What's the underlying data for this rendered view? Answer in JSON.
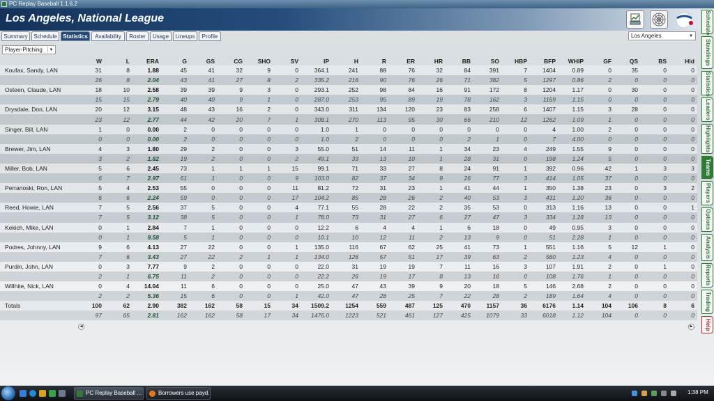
{
  "window": {
    "title": "PC Replay Baseball 1.1.6.2"
  },
  "header": {
    "team_title": "Los Angeles, National League"
  },
  "tabs": [
    "Summary",
    "Schedule",
    "Statistics",
    "Availability",
    "Roster",
    "Usage",
    "Lineups",
    "Profile"
  ],
  "active_tab": "Statistics",
  "team_select": {
    "value": "Los Angeles"
  },
  "view_select": {
    "value": "Player-Pitching"
  },
  "columns": [
    "W",
    "L",
    "ERA",
    "G",
    "GS",
    "CG",
    "SHO",
    "SV",
    "IP",
    "H",
    "R",
    "ER",
    "HR",
    "BB",
    "SO",
    "HBP",
    "BFP",
    "WHIP",
    "GF",
    "QS",
    "BS",
    "Hld"
  ],
  "rows": [
    {
      "name": "Koufax, Sandy, LAN",
      "kind": "main",
      "v": [
        "31",
        "8",
        "1.88",
        "45",
        "41",
        "32",
        "9",
        "0",
        "364.1",
        "241",
        "88",
        "76",
        "32",
        "84",
        "391",
        "7",
        "1404",
        "0.89",
        "0",
        "35",
        "0",
        "0"
      ]
    },
    {
      "name": "",
      "kind": "proj",
      "v": [
        "26",
        "8",
        "2.04",
        "43",
        "41",
        "27",
        "8",
        "2",
        "335.2",
        "216",
        "90",
        "76",
        "26",
        "71",
        "382",
        "5",
        "1297",
        "0.86",
        "2",
        "0",
        "0",
        "0"
      ]
    },
    {
      "name": "Osteen, Claude, LAN",
      "kind": "main",
      "v": [
        "18",
        "10",
        "2.58",
        "39",
        "39",
        "9",
        "3",
        "0",
        "293.1",
        "252",
        "98",
        "84",
        "16",
        "91",
        "172",
        "8",
        "1204",
        "1.17",
        "0",
        "30",
        "0",
        "0"
      ]
    },
    {
      "name": "",
      "kind": "proj",
      "v": [
        "15",
        "15",
        "2.79",
        "40",
        "40",
        "9",
        "1",
        "0",
        "287.0",
        "253",
        "95",
        "89",
        "19",
        "78",
        "162",
        "3",
        "1169",
        "1.15",
        "0",
        "0",
        "0",
        "0"
      ]
    },
    {
      "name": "Drysdale, Don, LAN",
      "kind": "main",
      "v": [
        "20",
        "12",
        "3.15",
        "48",
        "43",
        "16",
        "2",
        "0",
        "343.0",
        "311",
        "134",
        "120",
        "23",
        "83",
        "258",
        "6",
        "1407",
        "1.15",
        "3",
        "28",
        "0",
        "0"
      ]
    },
    {
      "name": "",
      "kind": "proj",
      "v": [
        "23",
        "12",
        "2.77",
        "44",
        "42",
        "20",
        "7",
        "1",
        "308.1",
        "270",
        "113",
        "95",
        "30",
        "66",
        "210",
        "12",
        "1262",
        "1.09",
        "1",
        "0",
        "0",
        "0"
      ]
    },
    {
      "name": "Singer, Bill, LAN",
      "kind": "main",
      "v": [
        "1",
        "0",
        "0.00",
        "2",
        "0",
        "0",
        "0",
        "0",
        "1.0",
        "1",
        "0",
        "0",
        "0",
        "0",
        "0",
        "0",
        "4",
        "1.00",
        "2",
        "0",
        "0",
        "0"
      ]
    },
    {
      "name": "",
      "kind": "proj",
      "v": [
        "0",
        "0",
        "0.00",
        "2",
        "0",
        "0",
        "0",
        "0",
        "1.0",
        "2",
        "0",
        "0",
        "0",
        "2",
        "1",
        "0",
        "7",
        "4.00",
        "0",
        "0",
        "0",
        "0"
      ]
    },
    {
      "name": "Brewer, Jim, LAN",
      "kind": "main",
      "v": [
        "4",
        "3",
        "1.80",
        "29",
        "2",
        "0",
        "0",
        "3",
        "55.0",
        "51",
        "14",
        "11",
        "1",
        "34",
        "23",
        "4",
        "249",
        "1.55",
        "9",
        "0",
        "0",
        "0"
      ]
    },
    {
      "name": "",
      "kind": "proj",
      "v": [
        "3",
        "2",
        "1.82",
        "19",
        "2",
        "0",
        "0",
        "2",
        "49.1",
        "33",
        "13",
        "10",
        "1",
        "28",
        "31",
        "0",
        "198",
        "1.24",
        "5",
        "0",
        "0",
        "0"
      ]
    },
    {
      "name": "Miller, Bob, LAN",
      "kind": "main",
      "v": [
        "5",
        "6",
        "2.45",
        "73",
        "1",
        "1",
        "1",
        "15",
        "99.1",
        "71",
        "33",
        "27",
        "8",
        "24",
        "91",
        "1",
        "392",
        "0.96",
        "42",
        "1",
        "3",
        "3"
      ]
    },
    {
      "name": "",
      "kind": "proj",
      "v": [
        "6",
        "7",
        "2.97",
        "61",
        "1",
        "0",
        "0",
        "9",
        "103.0",
        "82",
        "37",
        "34",
        "9",
        "26",
        "77",
        "3",
        "414",
        "1.05",
        "37",
        "0",
        "0",
        "0"
      ]
    },
    {
      "name": "Perranoski, Ron, LAN",
      "kind": "main",
      "v": [
        "5",
        "4",
        "2.53",
        "55",
        "0",
        "0",
        "0",
        "11",
        "81.2",
        "72",
        "31",
        "23",
        "1",
        "41",
        "44",
        "1",
        "350",
        "1.38",
        "23",
        "0",
        "3",
        "2"
      ]
    },
    {
      "name": "",
      "kind": "proj",
      "v": [
        "6",
        "6",
        "2.24",
        "59",
        "0",
        "0",
        "0",
        "17",
        "104.2",
        "85",
        "28",
        "26",
        "2",
        "40",
        "53",
        "3",
        "431",
        "1.20",
        "36",
        "0",
        "0",
        "0"
      ]
    },
    {
      "name": "Reed, Howie, LAN",
      "kind": "main",
      "v": [
        "7",
        "5",
        "2.56",
        "37",
        "5",
        "0",
        "0",
        "4",
        "77.1",
        "55",
        "28",
        "22",
        "2",
        "35",
        "53",
        "0",
        "313",
        "1.16",
        "13",
        "0",
        "0",
        "1"
      ]
    },
    {
      "name": "",
      "kind": "proj",
      "v": [
        "7",
        "5",
        "3.12",
        "38",
        "5",
        "0",
        "0",
        "1",
        "78.0",
        "73",
        "31",
        "27",
        "6",
        "27",
        "47",
        "3",
        "334",
        "1.28",
        "13",
        "0",
        "0",
        "0"
      ]
    },
    {
      "name": "Kekich, Mike, LAN",
      "kind": "main",
      "v": [
        "0",
        "1",
        "2.84",
        "7",
        "1",
        "0",
        "0",
        "0",
        "12.2",
        "6",
        "4",
        "4",
        "1",
        "6",
        "18",
        "0",
        "49",
        "0.95",
        "3",
        "0",
        "0",
        "0"
      ]
    },
    {
      "name": "",
      "kind": "proj",
      "v": [
        "0",
        "1",
        "9.58",
        "5",
        "1",
        "0",
        "0",
        "0",
        "10.1",
        "10",
        "12",
        "11",
        "2",
        "13",
        "9",
        "0",
        "51",
        "2.28",
        "1",
        "0",
        "0",
        "0"
      ]
    },
    {
      "name": "Podres, Johnny, LAN",
      "kind": "main",
      "v": [
        "9",
        "6",
        "4.13",
        "27",
        "22",
        "0",
        "0",
        "1",
        "135.0",
        "116",
        "67",
        "62",
        "25",
        "41",
        "73",
        "1",
        "551",
        "1.16",
        "5",
        "12",
        "1",
        "0"
      ]
    },
    {
      "name": "",
      "kind": "proj",
      "v": [
        "7",
        "6",
        "3.43",
        "27",
        "22",
        "2",
        "1",
        "1",
        "134.0",
        "126",
        "57",
        "51",
        "17",
        "39",
        "63",
        "2",
        "560",
        "1.23",
        "4",
        "0",
        "0",
        "0"
      ]
    },
    {
      "name": "Purdin, John, LAN",
      "kind": "main",
      "v": [
        "0",
        "3",
        "7.77",
        "9",
        "2",
        "0",
        "0",
        "0",
        "22.0",
        "31",
        "19",
        "19",
        "7",
        "11",
        "16",
        "3",
        "107",
        "1.91",
        "2",
        "0",
        "1",
        "0"
      ]
    },
    {
      "name": "",
      "kind": "proj",
      "v": [
        "2",
        "1",
        "6.75",
        "11",
        "2",
        "0",
        "0",
        "0",
        "22.2",
        "26",
        "19",
        "17",
        "8",
        "13",
        "16",
        "0",
        "108",
        "1.76",
        "1",
        "0",
        "0",
        "0"
      ]
    },
    {
      "name": "Willhite, Nick, LAN",
      "kind": "main",
      "v": [
        "0",
        "4",
        "14.04",
        "11",
        "6",
        "0",
        "0",
        "0",
        "25.0",
        "47",
        "43",
        "39",
        "9",
        "20",
        "18",
        "5",
        "146",
        "2.68",
        "2",
        "0",
        "0",
        "0"
      ]
    },
    {
      "name": "",
      "kind": "proj",
      "v": [
        "2",
        "2",
        "5.36",
        "15",
        "6",
        "0",
        "0",
        "1",
        "42.0",
        "47",
        "28",
        "25",
        "7",
        "22",
        "28",
        "2",
        "189",
        "1.64",
        "4",
        "0",
        "0",
        "0"
      ]
    },
    {
      "name": "Totals",
      "kind": "tot",
      "v": [
        "100",
        "62",
        "2.90",
        "382",
        "162",
        "58",
        "15",
        "34",
        "1509.2",
        "1254",
        "559",
        "487",
        "125",
        "470",
        "1157",
        "36",
        "6176",
        "1.14",
        "104",
        "106",
        "8",
        "6"
      ]
    },
    {
      "name": "",
      "kind": "proj",
      "v": [
        "97",
        "65",
        "2.81",
        "162",
        "162",
        "58",
        "17",
        "34",
        "1476.0",
        "1223",
        "521",
        "461",
        "127",
        "425",
        "1079",
        "33",
        "6018",
        "1.12",
        "104",
        "0",
        "0",
        "0"
      ]
    }
  ],
  "sidebar_tabs": [
    "Schedule",
    "Standings",
    "Statistics",
    "Leaders",
    "Highlights",
    "Teams",
    "Players",
    "Options",
    "Analysis",
    "Reports",
    "Trading",
    "Help"
  ],
  "sidebar_active": "Teams",
  "taskbar": {
    "items": [
      "PC Replay Baseball ...",
      "Borrowers use payd..."
    ],
    "clock": "1:38 PM"
  },
  "icons": {
    "chart_button": "chart-icon",
    "web_button": "spiderweb-icon",
    "team_logo": "dodgers-logo-icon",
    "start": "windows-start-icon"
  },
  "colors": {
    "header_dark": "#14325a",
    "active_tab": "#254a78",
    "sidebar_green": "#2f7a34",
    "help_red": "#b03030"
  }
}
